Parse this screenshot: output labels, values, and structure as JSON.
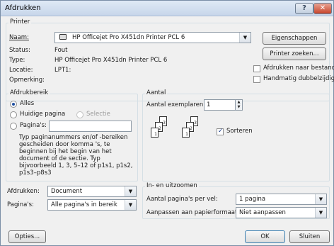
{
  "window": {
    "title": "Afdrukken",
    "help_glyph": "?",
    "close_glyph": "✕"
  },
  "printer": {
    "group_label": "Printer",
    "name_label": "Naam:",
    "name_value": "HP Officejet Pro X451dn Printer PCL 6",
    "properties_button": "Eigenschappen",
    "find_button": "Printer zoeken...",
    "status_label": "Status:",
    "status_value": "Fout",
    "type_label": "Type:",
    "type_value": "HP Officejet Pro X451dn Printer PCL 6",
    "location_label": "Locatie:",
    "location_value": "LPT1:",
    "comment_label": "Opmerking:",
    "print_to_file": {
      "label": "Afdrukken naar bestand",
      "checked": false
    },
    "manual_duplex": {
      "label": "Handmatig dubbelzijdig",
      "checked": false
    }
  },
  "range": {
    "group_label": "Afdrukbereik",
    "all": {
      "label": "Alles",
      "selected": true
    },
    "current": {
      "label": "Huidige pagina",
      "selected": false
    },
    "selection": {
      "label": "Selectie",
      "enabled": false
    },
    "pages": {
      "label": "Pagina's:",
      "value": ""
    },
    "help": "Typ paginanummers en/of -bereiken\ngescheiden door komma 's, te\nbeginnen bij het begin van het\ndocument of de sectie. Typ\nbijvoorbeeld 1, 3, 5–12 of p1s1, p1s2,\np1s3–p8s3"
  },
  "copies": {
    "group_label": "Aantal",
    "copies_label": "Aantal exemplaren:",
    "copies_value": "1",
    "collate": {
      "label": "Sorteren",
      "checked": true
    },
    "sheet_numbers": [
      "3",
      "2",
      "1",
      "3",
      "2",
      "1"
    ]
  },
  "print_what": {
    "label": "Afdrukken:",
    "value": "Document"
  },
  "print_pages": {
    "label": "Pagina's:",
    "value": "Alle pagina's in bereik"
  },
  "zoom": {
    "group_label": "In- en uitzoomen",
    "pages_per_sheet_label": "Aantal pagina's per vel:",
    "pages_per_sheet_value": "1 pagina",
    "scale_label": "Aanpassen aan papierformaat:",
    "scale_value": "Niet aanpassen"
  },
  "footer": {
    "options_button": "Opties...",
    "ok_button": "OK",
    "close_button": "Sluiten"
  },
  "icons": {
    "dropdown": "▼",
    "spin_up": "▲",
    "spin_down": "▼"
  }
}
